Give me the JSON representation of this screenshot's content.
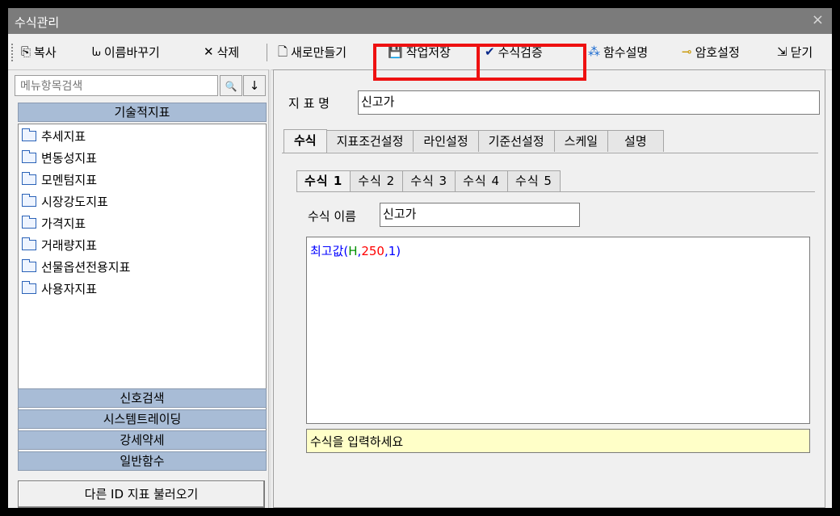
{
  "window": {
    "title": "수식관리",
    "close_glyph": "×"
  },
  "toolbar": {
    "copy": {
      "label": "복사",
      "icon": "copy-icon",
      "glyph": "⎘"
    },
    "rename": {
      "label": "이름바꾸기",
      "icon": "rename-icon",
      "glyph": "ᘈ"
    },
    "delete": {
      "label": "삭제",
      "icon": "delete-icon",
      "glyph": "✕"
    },
    "new": {
      "label": "새로만들기",
      "icon": "new-document-icon",
      "glyph": "🗋"
    },
    "save": {
      "label": "작업저장",
      "icon": "save-disk-icon",
      "glyph": "💾"
    },
    "verify": {
      "label": "수식검증",
      "icon": "checkmark-icon",
      "glyph": "✔"
    },
    "func_help": {
      "label": "함수설명",
      "icon": "magic-wand-icon",
      "glyph": "⁂"
    },
    "password": {
      "label": "암호설정",
      "icon": "key-icon",
      "glyph": "⊸"
    },
    "close": {
      "label": "닫기",
      "icon": "exit-icon",
      "glyph": "⇲"
    },
    "highlight_color": "#ee1111"
  },
  "sidebar": {
    "search_placeholder": "메뉴항목검색",
    "search_glyph": "🔍",
    "down_glyph": "↓",
    "category_title": "기술적지표",
    "tree_items": [
      {
        "label": "추세지표"
      },
      {
        "label": "변동성지표"
      },
      {
        "label": "모멘텀지표"
      },
      {
        "label": "시장강도지표"
      },
      {
        "label": "가격지표"
      },
      {
        "label": "거래량지표"
      },
      {
        "label": "선물옵션전용지표"
      },
      {
        "label": "사용자지표"
      }
    ],
    "bottom_categories": [
      "신호검색",
      "시스템트레이딩",
      "강세약세",
      "일반함수"
    ],
    "load_button": "다른 ID 지표 불러오기",
    "category_color": "#a8bcd6"
  },
  "main": {
    "indicator_name_label": "지 표 명",
    "indicator_name_value": "신고가",
    "tabs": [
      "수식",
      "지표조건설정",
      "라인설정",
      "기준선설정",
      "스케일",
      "설명"
    ],
    "active_tab": "수식",
    "formula_tabs": [
      "수식 1",
      "수식 2",
      "수식 3",
      "수식 4",
      "수식 5"
    ],
    "active_formula_tab": "수식 1",
    "formula_name_label": "수식 이름",
    "formula_name_value": "신고가",
    "formula": {
      "func": "최고값",
      "open": "(",
      "arg1": "H",
      "comma1": ",",
      "arg2": "250",
      "comma2": ",",
      "arg3": "1",
      "close": ")"
    },
    "formula_colors": {
      "func": "#0000ff",
      "arg1": "#009000",
      "arg2": "#ff0000",
      "arg3": "#0000ff"
    },
    "hint_text": "수식을 입력하세요",
    "hint_color": "#ffffc8"
  }
}
